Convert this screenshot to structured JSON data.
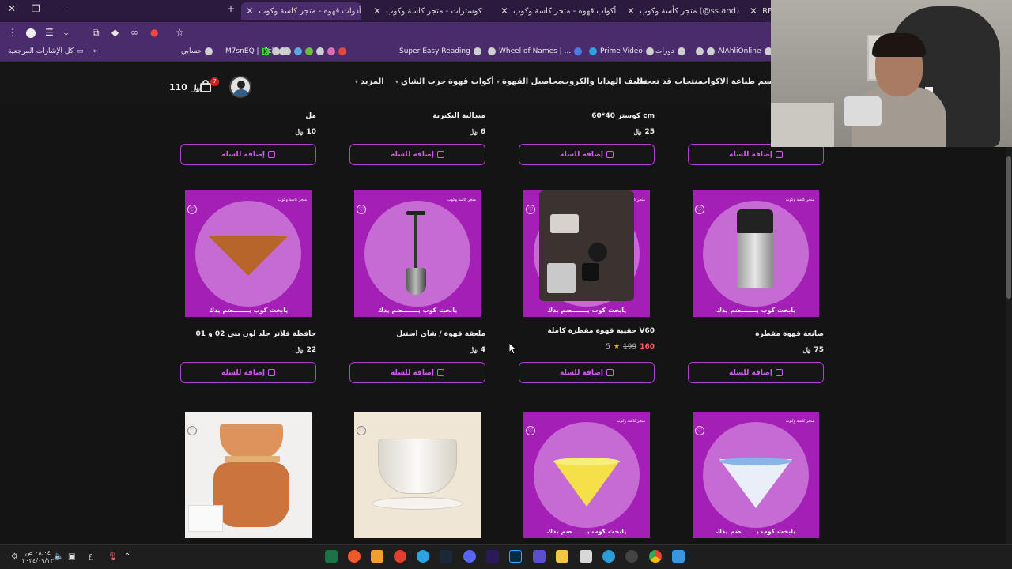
{
  "browser": {
    "tabs": [
      {
        "label": "متجر كأسة وكوب (@ss.and.cup)",
        "active": false
      },
      {
        "label": "أكواب قهوة - متجر كاسة وكوب",
        "active": false
      },
      {
        "label": "كوسترات - متجر كاسة وكوب",
        "active": false
      },
      {
        "label": "أدوات قهوة - متجر كاسة وكوب",
        "active": true
      }
    ],
    "partial_tab_label": "RED",
    "bookmarks": [
      {
        "label": "كل الإشارات المرجعية"
      },
      {
        "label": "حسابي"
      },
      {
        "label": "M7snEQ | Kick"
      },
      {
        "label": "Super Easy Reading"
      },
      {
        "label": "Wheel of Names | ..."
      },
      {
        "label": "Prime Video"
      },
      {
        "label": "دورات"
      },
      {
        "label": "AlAhliOnline"
      }
    ]
  },
  "navbar": {
    "items": [
      {
        "label": "قسم طباعة الاكواب",
        "has_chevron": false
      },
      {
        "label": "منتجات قد تعجبك",
        "has_chevron": false
      },
      {
        "label": "تغليف الهدايا والكروت",
        "has_chevron": false
      },
      {
        "label": "محاصيل القهوة",
        "has_chevron": true
      },
      {
        "label": "أكواب قهوة",
        "has_chevron": false
      },
      {
        "label": "حزب الشاي",
        "has_chevron": true
      },
      {
        "label": "المزيد",
        "has_chevron": true
      }
    ],
    "cart_count": "7",
    "cart_total": "110 ﷼"
  },
  "add_to_cart_label": "إضافة للسلة",
  "currency": "﷼",
  "row1": [
    {
      "name": "كوستر 40*60 cm",
      "price": "25"
    },
    {
      "name": "ميدالية البكيرية",
      "price": "6"
    },
    {
      "name": "مل",
      "price": "10"
    }
  ],
  "row2": [
    {
      "name": "صانعة قهوة مقطرة",
      "price": "75",
      "tagline": "يابخت كوب يـــــــضم يدك",
      "brand": "متجر كاسة وكوب"
    },
    {
      "name": "حقيبة قهوة مقطرة كاملة V60",
      "sale_price": "160",
      "old_price": "199",
      "rating": "5",
      "tagline": "يابخت كوب يـــــــضم يدك",
      "brand": "متجر كاسة وكوب"
    },
    {
      "name": "ملعقة قهوة / شاي استيل",
      "price": "4",
      "tagline": "يابخت كوب يـــــــضم يدك",
      "brand": "متجر كاسة وكوب"
    },
    {
      "name": "حافظة فلاتر جلد لون بني 02 و 01",
      "price": "22",
      "tagline": "يابخت كوب يـــــــضم يدك",
      "brand": "متجر كاسة وكوب"
    }
  ],
  "row3": [
    {
      "tagline": "يابخت كوب يـــــــضم يدك",
      "brand": "متجر كاسة وكوب"
    },
    {
      "tagline": "يابخت كوب يـــــــضم يدك",
      "brand": "متجر كاسة وكوب"
    }
  ],
  "taskbar": {
    "lang": "ع",
    "time": "٠٨:٠٤ ص",
    "date": "٢٠٢٤/٠٩/١٣"
  },
  "colors": {
    "accent": "#b040d0",
    "product_bg": "#a31fb5",
    "page_bg": "#141414"
  }
}
